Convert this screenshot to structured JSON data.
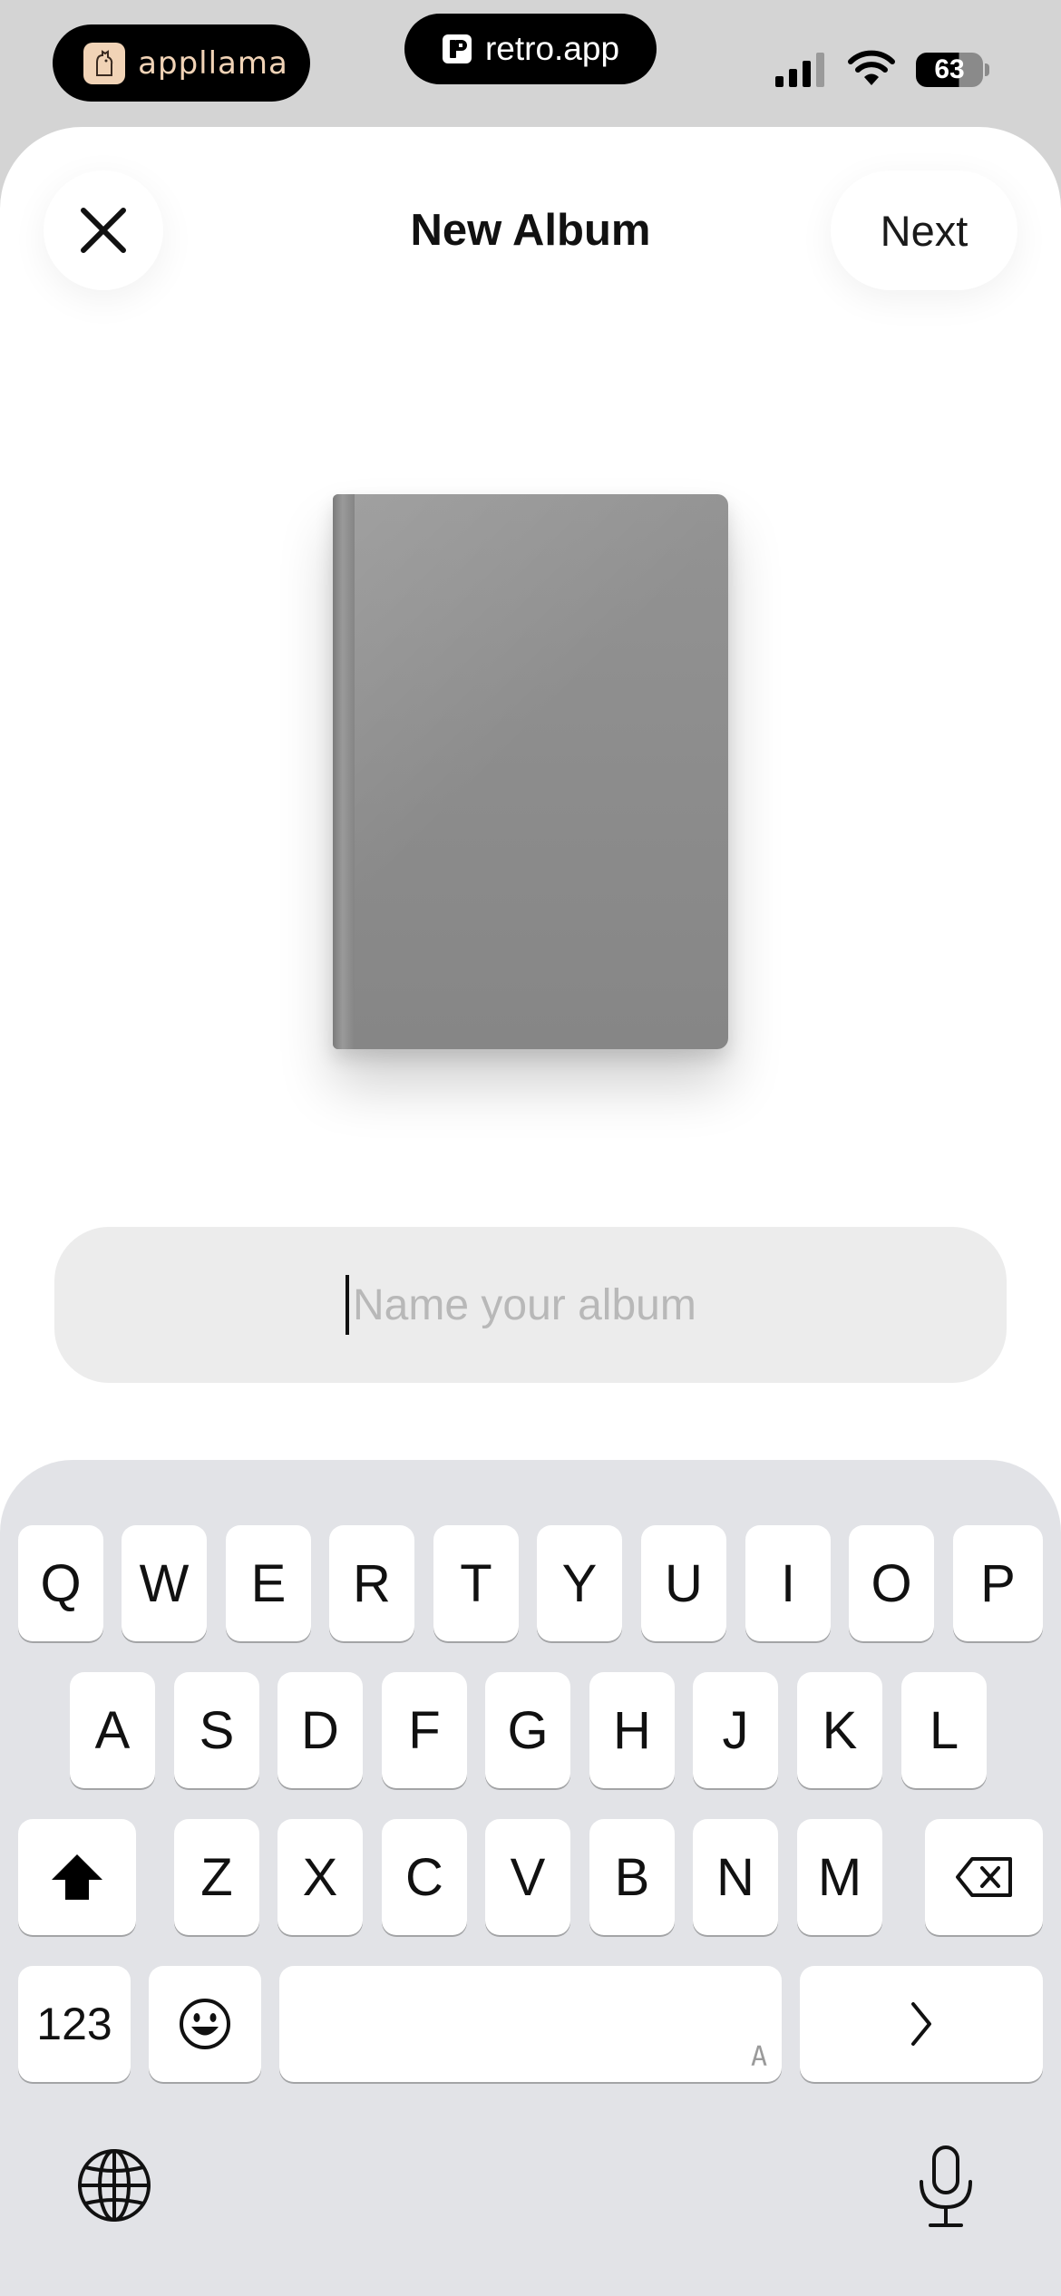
{
  "status_bar": {
    "app_pill": {
      "label": "appllama",
      "icon": "llama-logo-icon"
    },
    "url_pill": {
      "label": "retro.app",
      "icon": "retro-logo-icon"
    },
    "signal_icon": "cellular-signal-icon",
    "wifi_icon": "wifi-icon",
    "battery": "63"
  },
  "header": {
    "close_icon": "close-icon",
    "title": "New Album",
    "next_label": "Next"
  },
  "album": {
    "cover_icon": "album-book-icon"
  },
  "name_field": {
    "value": "",
    "placeholder": "Name your album"
  },
  "keyboard": {
    "row1": [
      "Q",
      "W",
      "E",
      "R",
      "T",
      "Y",
      "U",
      "I",
      "O",
      "P"
    ],
    "row2": [
      "A",
      "S",
      "D",
      "F",
      "G",
      "H",
      "J",
      "K",
      "L"
    ],
    "row3": [
      "Z",
      "X",
      "C",
      "V",
      "B",
      "N",
      "M"
    ],
    "numbers_label": "123",
    "space_hint": "A",
    "shift_icon": "shift-icon",
    "delete_icon": "delete-icon",
    "emoji_icon": "emoji-icon",
    "next_icon": "chevron-right-icon",
    "globe_icon": "globe-icon",
    "mic_icon": "microphone-icon"
  },
  "colors": {
    "status_bg": "#d4d4d4",
    "sheet_bg": "#ffffff",
    "field_bg": "#ececec",
    "keyboard_bg": "#e2e3e7",
    "album_cover": "#8c8c8c",
    "llama_accent": "#f1d3b6"
  }
}
